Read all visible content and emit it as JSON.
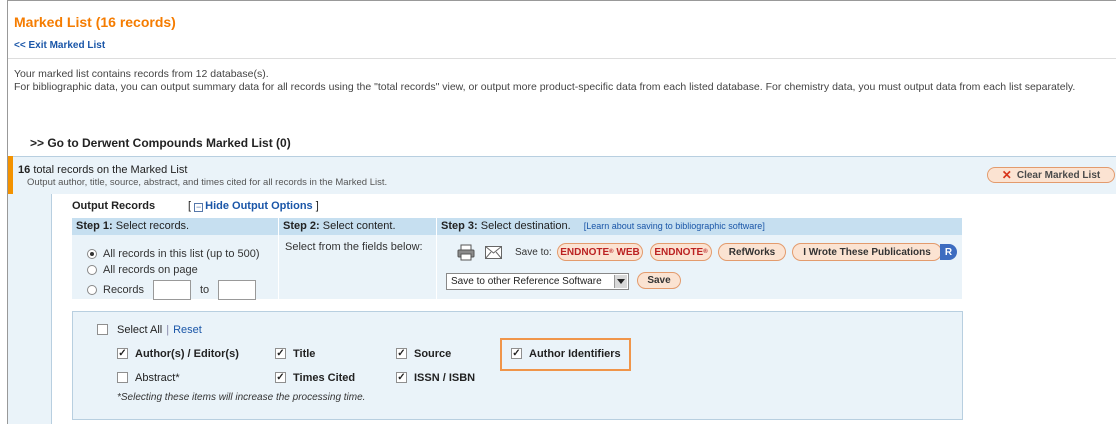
{
  "page": {
    "title": "Marked List (16 records)",
    "exit_link": "<< Exit Marked List",
    "intro_line1": "Your marked list contains records from 12 database(s).",
    "intro_line2": "For bibliographic data, you can output summary data for all records using the \"total records\" view, or output more product-specific data from each listed database. For chemistry data, you must output data from each list separately.",
    "derwent_link": ">> Go to Derwent Compounds Marked List (0)"
  },
  "panel": {
    "total_count": "16",
    "total_text": "total records on the Marked List",
    "total_sub": "Output author, title, source, abstract, and times cited for all records in the Marked List.",
    "clear_button": "Clear Marked List"
  },
  "output": {
    "heading": "Output Records",
    "hide_options": "Hide Output Options",
    "bracket_open": "[",
    "bracket_close": "]"
  },
  "steps": {
    "step1_label": "Step 1:",
    "step1_text": "Select records.",
    "step2_label": "Step 2:",
    "step2_text": "Select content.",
    "step3_label": "Step 3:",
    "step3_text": "Select destination.",
    "step3_link": "[Learn about saving to bibliographic software]"
  },
  "records": {
    "opt_all": "All records in this list (up to 500)",
    "opt_page": "All records on page",
    "opt_range": "Records",
    "opt_to": "to",
    "selected": "all"
  },
  "content": {
    "select_fields": "Select from the fields below:"
  },
  "destination": {
    "save_to": "Save to:",
    "endnote_web": "ENDNOTE",
    "endnote_web_suffix": "WEB",
    "endnote": "ENDNOTE",
    "refworks": "RefWorks",
    "i_wrote": "I Wrote These Publications",
    "r_badge": "R",
    "dropdown_value": "Save to other Reference Software",
    "save_button": "Save"
  },
  "fields": {
    "select_all": "Select All",
    "reset": "Reset",
    "divider": "|",
    "authors": "Author(s) / Editor(s)",
    "title": "Title",
    "source": "Source",
    "author_ids": "Author Identifiers",
    "abstract": "Abstract*",
    "times_cited": "Times Cited",
    "issn": "ISSN / ISBN",
    "check_mark": "✓",
    "note": "*Selecting these items will increase the processing time."
  },
  "colors": {
    "title_orange": "#f57c00",
    "link_blue": "#1a56a8",
    "panel_bg": "#eaf3f9",
    "step_header_bg": "#c6dff0",
    "pill_bg": "#fbe3d2",
    "highlight": "#f0954a"
  }
}
